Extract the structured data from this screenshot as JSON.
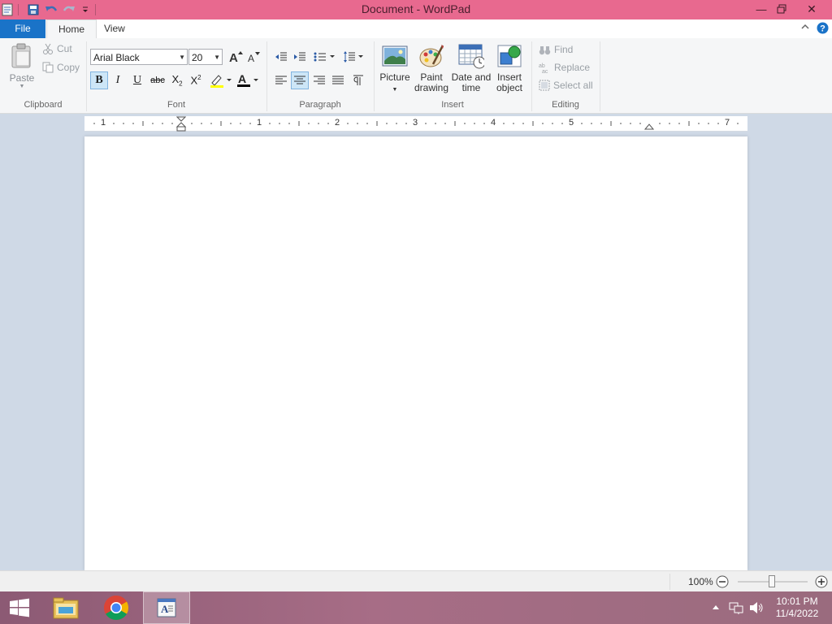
{
  "window": {
    "title": "Document - WordPad"
  },
  "ribbon_tabs": {
    "file": "File",
    "home": "Home",
    "view": "View"
  },
  "clipboard": {
    "paste": "Paste",
    "cut": "Cut",
    "copy": "Copy",
    "label": "Clipboard"
  },
  "font": {
    "name": "Arial Black",
    "size": "20",
    "label": "Font"
  },
  "paragraph": {
    "label": "Paragraph"
  },
  "insert": {
    "picture": "Picture",
    "paint_line1": "Paint",
    "paint_line2": "drawing",
    "datetime_line1": "Date and",
    "datetime_line2": "time",
    "object_line1": "Insert",
    "object_line2": "object",
    "label": "Insert"
  },
  "editing": {
    "find": "Find",
    "replace": "Replace",
    "select_all": "Select all",
    "label": "Editing"
  },
  "ruler": {
    "numbers": [
      "1",
      "1",
      "2",
      "3",
      "4",
      "5",
      "7"
    ]
  },
  "status": {
    "zoom": "100%"
  },
  "taskbar": {
    "time": "10:01 PM",
    "date": "11/4/2022"
  },
  "colors": {
    "titlebar": "#e8698f",
    "file_tab": "#1a73c8",
    "font_color_bar": "#000000",
    "highlight_bar": "#ffff00"
  }
}
